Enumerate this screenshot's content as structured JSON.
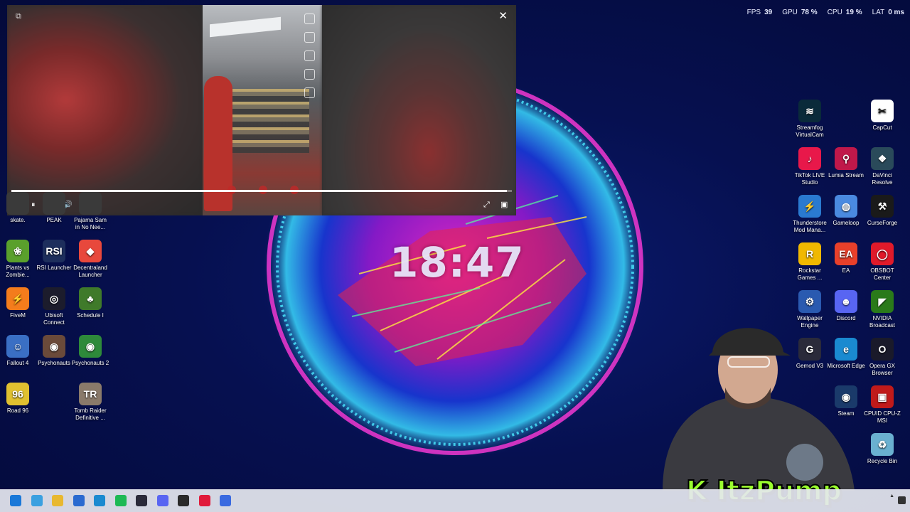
{
  "perf_overlay": {
    "fps_label": "FPS",
    "fps_value": "39",
    "gpu_label": "GPU",
    "gpu_value": "78 %",
    "cpu_label": "CPU",
    "cpu_value": "19 %",
    "lat_label": "LAT",
    "lat_value": "0 ms"
  },
  "clock": "18:47",
  "player": {
    "progress_fraction": 0.99
  },
  "left_icons": [
    {
      "label": "skate.",
      "color": "#3a3a3a",
      "glyph": "",
      "col": 0,
      "row": 0
    },
    {
      "label": "PEAK",
      "color": "#3a3a3a",
      "glyph": "",
      "col": 1,
      "row": 0
    },
    {
      "label": "Pajama Sam in No Nee...",
      "color": "#3a3a3a",
      "glyph": "",
      "col": 2,
      "row": 0
    },
    {
      "label": "Plants vs Zombie...",
      "color": "#5aa02c",
      "glyph": "❀",
      "col": 0,
      "row": 1
    },
    {
      "label": "RSI Launcher",
      "color": "#1d2e5c",
      "glyph": "RSI",
      "col": 1,
      "row": 1
    },
    {
      "label": "Decentraland Launcher",
      "color": "#e8483c",
      "glyph": "◆",
      "col": 2,
      "row": 1
    },
    {
      "label": "FiveM",
      "color": "#f47c1c",
      "glyph": "⚡",
      "col": 0,
      "row": 2
    },
    {
      "label": "Ubisoft Connect",
      "color": "#1c1c2c",
      "glyph": "◎",
      "col": 1,
      "row": 2
    },
    {
      "label": "Schedule I",
      "color": "#3f7a2a",
      "glyph": "♣",
      "col": 2,
      "row": 2
    },
    {
      "label": "Fallout 4",
      "color": "#3a6fc4",
      "glyph": "☺",
      "col": 0,
      "row": 3
    },
    {
      "label": "Psychonauts",
      "color": "#6a4a3a",
      "glyph": "◉",
      "col": 1,
      "row": 3
    },
    {
      "label": "Psychonauts 2",
      "color": "#2e8a3a",
      "glyph": "◉",
      "col": 2,
      "row": 3
    },
    {
      "label": "Road 96",
      "color": "#e0c030",
      "glyph": "96",
      "col": 0,
      "row": 4
    },
    {
      "label": "Tomb Raider Definitive ...",
      "color": "#8a7a6a",
      "glyph": "TR",
      "col": 2,
      "row": 4
    }
  ],
  "right_icons": [
    {
      "label": "Streamfog VirtualCam",
      "color": "#0a2a3a",
      "glyph": "≋",
      "col": 0,
      "row": 0
    },
    {
      "label": "CapCut",
      "color": "#ffffff",
      "glyph": "✂",
      "col": 2,
      "row": 0
    },
    {
      "label": "TikTok LIVE Studio",
      "color": "#e8184a",
      "glyph": "♪",
      "col": 0,
      "row": 1
    },
    {
      "label": "Lumia Stream",
      "color": "#c0184a",
      "glyph": "⚲",
      "col": 1,
      "row": 1
    },
    {
      "label": "DaVinci Resolve",
      "color": "#2a4a5a",
      "glyph": "❖",
      "col": 2,
      "row": 1
    },
    {
      "label": "Thunderstore Mod Mana...",
      "color": "#2a7ad0",
      "glyph": "⚡",
      "col": 0,
      "row": 2
    },
    {
      "label": "Gameloop",
      "color": "#4a8ae0",
      "glyph": "◍",
      "col": 1,
      "row": 2
    },
    {
      "label": "CurseForge",
      "color": "#1a1a1a",
      "glyph": "⚒",
      "col": 2,
      "row": 2
    },
    {
      "label": "Rockstar Games ...",
      "color": "#f0b800",
      "glyph": "R",
      "col": 0,
      "row": 3
    },
    {
      "label": "EA",
      "color": "#e8402a",
      "glyph": "EA",
      "col": 1,
      "row": 3
    },
    {
      "label": "OBSBOT Center",
      "color": "#e01a2a",
      "glyph": "◯",
      "col": 2,
      "row": 3
    },
    {
      "label": "Wallpaper Engine",
      "color": "#2a5ab0",
      "glyph": "⚙",
      "col": 0,
      "row": 4
    },
    {
      "label": "Discord",
      "color": "#5865f2",
      "glyph": "☻",
      "col": 1,
      "row": 4
    },
    {
      "label": "NVIDIA Broadcast",
      "color": "#2a7a1a",
      "glyph": "◤",
      "col": 2,
      "row": 4
    },
    {
      "label": "Gemod V3",
      "color": "#2a2a3a",
      "glyph": "G",
      "col": 0,
      "row": 5
    },
    {
      "label": "Microsoft Edge",
      "color": "#1a8ad0",
      "glyph": "e",
      "col": 1,
      "row": 5
    },
    {
      "label": "Opera GX Browser",
      "color": "#1a1a2a",
      "glyph": "O",
      "col": 2,
      "row": 5
    },
    {
      "label": "Steam",
      "color": "#1a3a6a",
      "glyph": "◉",
      "col": 1,
      "row": 6
    },
    {
      "label": "CPUID CPU-Z MSI",
      "color": "#c01a1a",
      "glyph": "▣",
      "col": 2,
      "row": 6
    },
    {
      "label": "Recycle Bin",
      "color": "#6ab0d0",
      "glyph": "♻",
      "col": 2,
      "row": 7
    }
  ],
  "streamer_name": "ItzPump",
  "taskbar_icons": [
    {
      "name": "start-icon",
      "color": "#1a78d8"
    },
    {
      "name": "copilot-icon",
      "color": "#3aa0e0"
    },
    {
      "name": "file-explorer-icon",
      "color": "#e8b830"
    },
    {
      "name": "store-icon",
      "color": "#2a6ad0"
    },
    {
      "name": "edge-icon",
      "color": "#1a8ad0"
    },
    {
      "name": "spotify-icon",
      "color": "#1db954"
    },
    {
      "name": "terminal-icon",
      "color": "#2a2a3a"
    },
    {
      "name": "discord-icon",
      "color": "#5865f2"
    },
    {
      "name": "obs-icon",
      "color": "#2a2a2a"
    },
    {
      "name": "opera-icon",
      "color": "#e01a3a"
    },
    {
      "name": "browser-icon",
      "color": "#3a6ae0"
    }
  ]
}
